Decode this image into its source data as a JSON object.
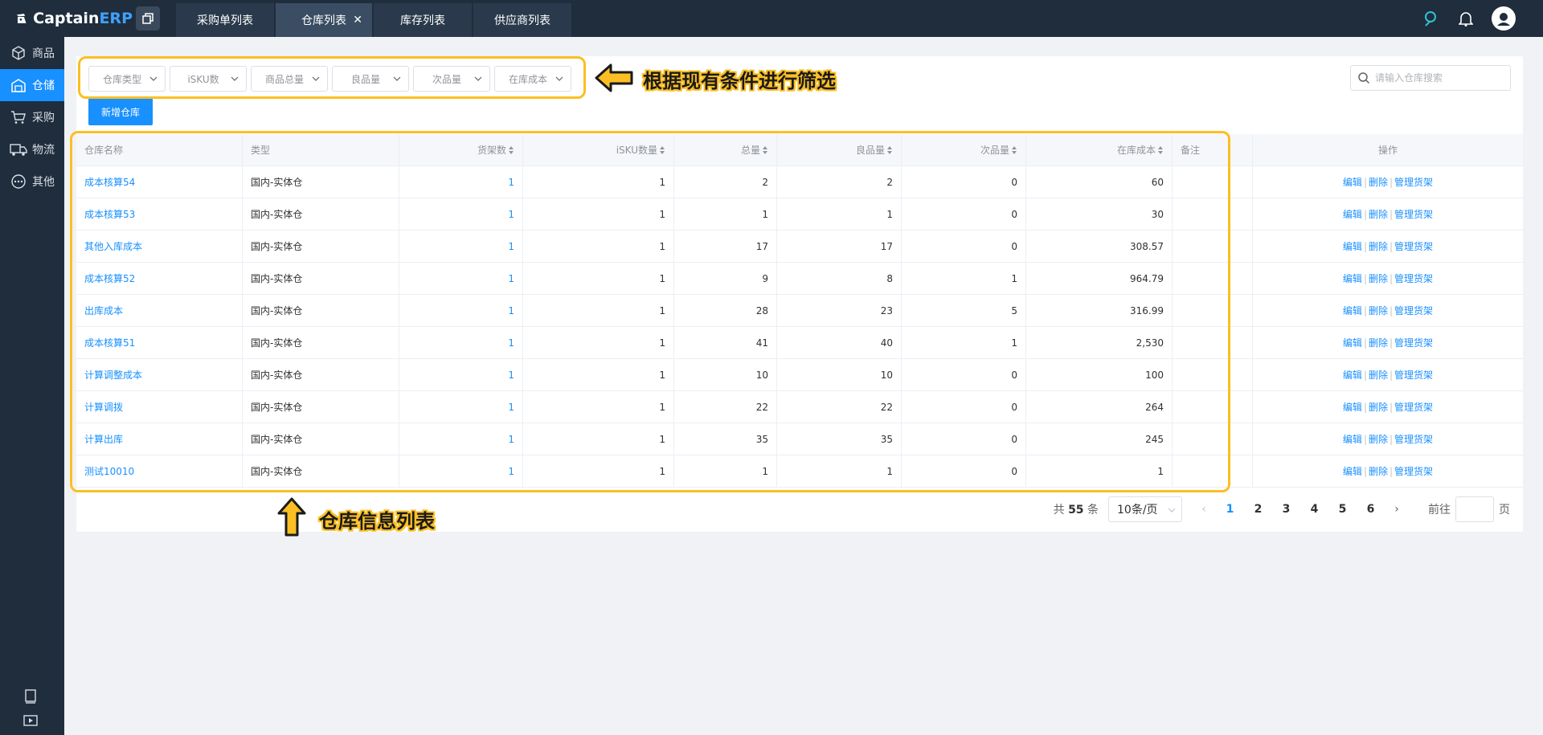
{
  "app": {
    "brand_captain": "Captain",
    "brand_erp": "ERP"
  },
  "tabs": [
    {
      "label": "采购单列表",
      "active": false
    },
    {
      "label": "仓库列表",
      "active": true,
      "closable": true
    },
    {
      "label": "库存列表",
      "active": false
    },
    {
      "label": "供应商列表",
      "active": false
    }
  ],
  "sidebar": {
    "items": [
      {
        "label": "商品",
        "icon": "cube-icon"
      },
      {
        "label": "仓储",
        "icon": "warehouse-icon",
        "active": true
      },
      {
        "label": "采购",
        "icon": "cart-icon"
      },
      {
        "label": "物流",
        "icon": "truck-icon"
      },
      {
        "label": "其他",
        "icon": "more-icon"
      }
    ]
  },
  "filters": [
    "仓库类型",
    "iSKU数",
    "商品总量",
    "良品量",
    "次品量",
    "在库成本"
  ],
  "search": {
    "placeholder": "请输入仓库搜索"
  },
  "add_button": "新增仓库",
  "table": {
    "headers": [
      "仓库名称",
      "类型",
      "货架数",
      "iSKU数量",
      "总量",
      "良品量",
      "次品量",
      "在库成本",
      "备注",
      "操作"
    ],
    "rows": [
      {
        "name": "成本核算54",
        "type": "国内-实体仓",
        "shelves": "1",
        "isku": "1",
        "total": "2",
        "good": "2",
        "defect": "0",
        "cost": "60",
        "note": ""
      },
      {
        "name": "成本核算53",
        "type": "国内-实体仓",
        "shelves": "1",
        "isku": "1",
        "total": "1",
        "good": "1",
        "defect": "0",
        "cost": "30",
        "note": ""
      },
      {
        "name": "其他入库成本",
        "type": "国内-实体仓",
        "shelves": "1",
        "isku": "1",
        "total": "17",
        "good": "17",
        "defect": "0",
        "cost": "308.57",
        "note": ""
      },
      {
        "name": "成本核算52",
        "type": "国内-实体仓",
        "shelves": "1",
        "isku": "1",
        "total": "9",
        "good": "8",
        "defect": "1",
        "cost": "964.79",
        "note": ""
      },
      {
        "name": "出库成本",
        "type": "国内-实体仓",
        "shelves": "1",
        "isku": "1",
        "total": "28",
        "good": "23",
        "defect": "5",
        "cost": "316.99",
        "note": ""
      },
      {
        "name": "成本核算51",
        "type": "国内-实体仓",
        "shelves": "1",
        "isku": "1",
        "total": "41",
        "good": "40",
        "defect": "1",
        "cost": "2,530",
        "note": ""
      },
      {
        "name": "计算调整成本",
        "type": "国内-实体仓",
        "shelves": "1",
        "isku": "1",
        "total": "10",
        "good": "10",
        "defect": "0",
        "cost": "100",
        "note": ""
      },
      {
        "name": "计算调拨",
        "type": "国内-实体仓",
        "shelves": "1",
        "isku": "1",
        "total": "22",
        "good": "22",
        "defect": "0",
        "cost": "264",
        "note": ""
      },
      {
        "name": "计算出库",
        "type": "国内-实体仓",
        "shelves": "1",
        "isku": "1",
        "total": "35",
        "good": "35",
        "defect": "0",
        "cost": "245",
        "note": ""
      },
      {
        "name": "测试10010",
        "type": "国内-实体仓",
        "shelves": "1",
        "isku": "1",
        "total": "1",
        "good": "1",
        "defect": "0",
        "cost": "1",
        "note": ""
      }
    ],
    "ops": {
      "edit": "编辑",
      "delete": "删除",
      "manage": "管理货架",
      "sep": "|"
    }
  },
  "pagination": {
    "total_prefix": "共",
    "total": "55",
    "total_suffix": "条",
    "page_size": "10条/页",
    "pages": [
      "1",
      "2",
      "3",
      "4",
      "5",
      "6"
    ],
    "current": "1",
    "goto_label": "前往",
    "page_suffix": "页"
  },
  "annotations": {
    "filter_note": "根据现有条件进行筛选",
    "table_note": "仓库信息列表",
    "color": "#fbbf24"
  }
}
